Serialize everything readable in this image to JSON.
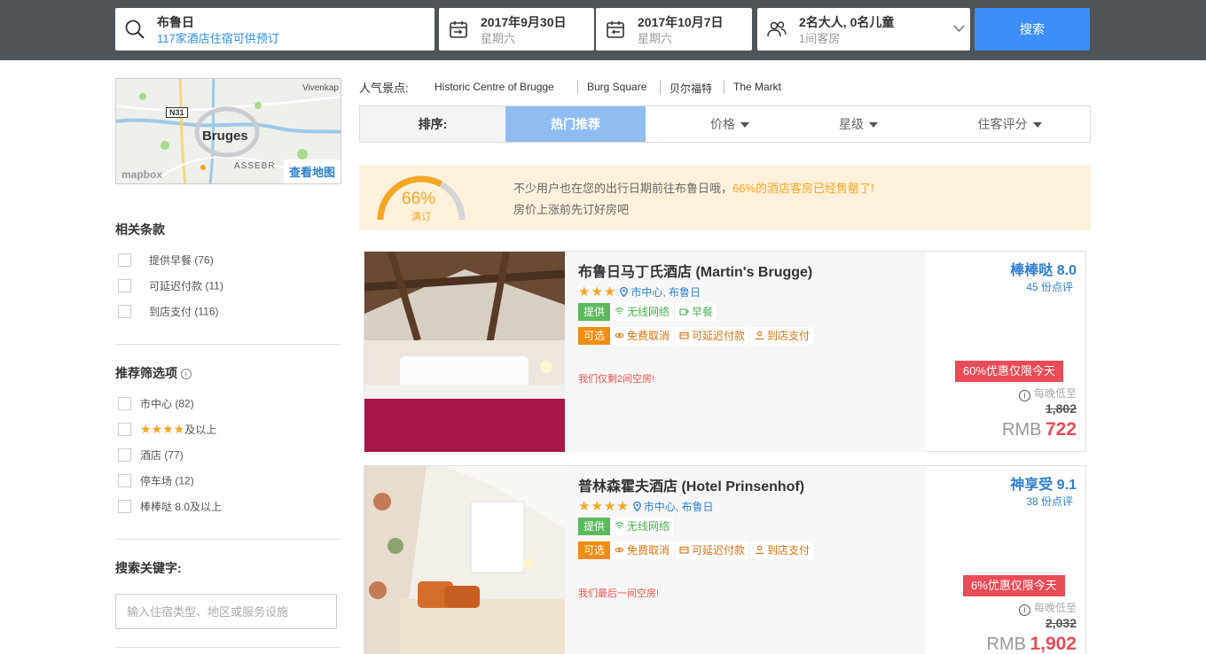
{
  "search": {
    "destination": "布鲁日",
    "destination_sub": "117家酒店住宿可供预订",
    "checkin_date": "2017年9月30日",
    "checkin_weekday": "星期六",
    "checkout_date": "2017年10月7日",
    "checkout_weekday": "星期六",
    "guests": "2名大人, 0名儿童",
    "rooms": "1间客房",
    "search_label": "搜索"
  },
  "map": {
    "city": "Bruges",
    "road": "N31",
    "place_top_right": "Vivenkap",
    "place_bottom": "ASSEBR",
    "brand": "mapbox",
    "view_map_label": "查看地图"
  },
  "filters": {
    "related_title": "相关条款",
    "related": [
      {
        "label": "提供早餐",
        "count": "(76)"
      },
      {
        "label": "可延迟付款",
        "count": "(11)"
      },
      {
        "label": "到店支付",
        "count": "(116)"
      }
    ],
    "recommended_title": "推荐筛选项",
    "recommended": [
      {
        "label": "市中心",
        "count": "(82)"
      },
      {
        "label": "★★★★",
        "count": "及以上"
      },
      {
        "label": "酒店",
        "count": "(77)"
      },
      {
        "label": "停车场",
        "count": "(12)"
      },
      {
        "label": "棒棒哒 8.0",
        "count": "及以上"
      }
    ],
    "keyword_title": "搜索关键字:",
    "keyword_placeholder": "输入住宿类型、地区或服务设施"
  },
  "attractions": {
    "label": "人气景点:",
    "items": [
      "Historic Centre of Brugge",
      "Burg Square",
      "贝尔福特",
      "The Markt"
    ]
  },
  "sort": {
    "label": "排序:",
    "active": "热门推荐",
    "price": "价格",
    "stars": "星级",
    "rating": "住客评分"
  },
  "banner": {
    "percent": "66%",
    "gauge_caption": "满订",
    "gauge_fraction": 0.66,
    "line1_prefix": "不少用户也在您的出行日期前往布鲁日哦，",
    "line1_pct": "66%",
    "line1_suffix": "的酒店客房已经售罄了!",
    "line2": "房价上涨前先订好房吧"
  },
  "hotels": [
    {
      "name": "布鲁日马丁氏酒店 (Martin's Brugge)",
      "stars": "★★★",
      "location": "市中心, 布鲁日",
      "provide_tag": "提供",
      "amenities": [
        "无线网络",
        "早餐"
      ],
      "option_tag": "可选",
      "options": [
        "免费取消",
        "可延迟付款",
        "到店支付"
      ],
      "rooms_left": "我们仅剩2间空房!",
      "score_label": "棒棒哒 8.0",
      "reviews": "45 份点评",
      "deal": "60%优惠仅限今天",
      "per_night": "每晚低至",
      "old_price": "1,802",
      "currency": "RMB",
      "price": "722"
    },
    {
      "name": "普林森霍夫酒店 (Hotel Prinsenhof)",
      "stars": "★★★★",
      "location": "市中心, 布鲁日",
      "provide_tag": "提供",
      "amenities": [
        "无线网络"
      ],
      "option_tag": "可选",
      "options": [
        "免费取消",
        "可延迟付款",
        "到店支付"
      ],
      "rooms_left": "我们最后一间空房!",
      "score_label": "神享受 9.1",
      "reviews": "38 份点评",
      "deal": "6%优惠仅限今天",
      "per_night": "每晚低至",
      "old_price": "2,032",
      "currency": "RMB",
      "price": "1,902"
    }
  ],
  "colors": {
    "header_bg": "#4f5458",
    "accent_blue": "#3e8ef7",
    "link_blue": "#2f7fd0",
    "orange": "#f5a623",
    "deal_red": "#e94b57",
    "banner_bg": "#fdf1dc"
  }
}
